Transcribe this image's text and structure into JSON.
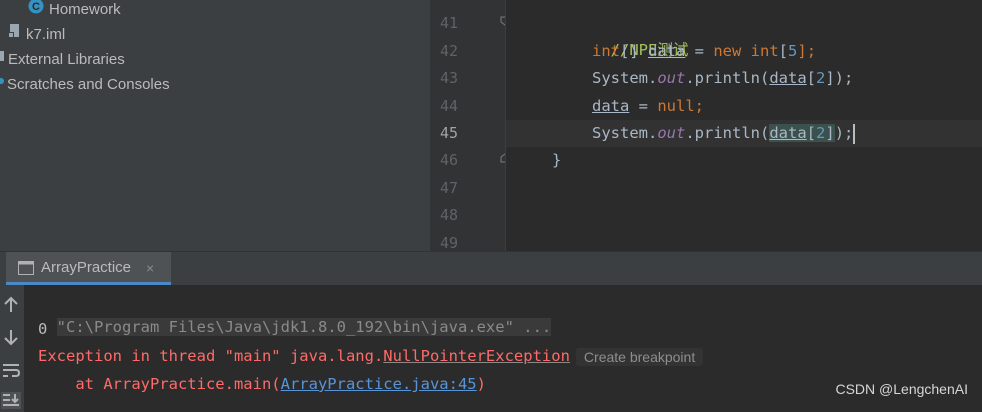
{
  "project_tree": {
    "items": [
      {
        "label": "Homework",
        "icon": "java-class-icon"
      },
      {
        "label": "k7.iml",
        "icon": "module-file-icon"
      },
      {
        "label": "External Libraries",
        "icon": "library-icon"
      },
      {
        "label": "Scratches and Consoles",
        "icon": "scratches-icon"
      }
    ]
  },
  "editor": {
    "line_numbers": [
      "41",
      "42",
      "43",
      "44",
      "45",
      "46",
      "47",
      "48",
      "49"
    ],
    "active_line": "45",
    "lines": {
      "l41": "//NPE测试",
      "l42": [
        "int",
        "[] ",
        "data",
        " = ",
        "new",
        " ",
        "int",
        "[",
        "5",
        "];"
      ],
      "l43": [
        "System.",
        "out",
        ".println(",
        "data",
        "[",
        "2",
        "]);"
      ],
      "l44": [
        "data",
        " = ",
        "null",
        ";"
      ],
      "l45": [
        "System.",
        "out",
        ".println(",
        "data",
        "[",
        "2",
        "]",
        ");"
      ],
      "l46": "}"
    }
  },
  "run_panel": {
    "tab_label": "ArrayPractice",
    "tab_close": "×",
    "console": {
      "cmd": "\"C:\\Program Files\\Java\\jdk1.8.0_192\\bin\\java.exe\" ...",
      "output": "0",
      "exception_prefix": "Exception in thread \"main\" java.lang.",
      "exception_class": "NullPointerException",
      "create_breakpoint": "Create breakpoint",
      "stack_prefix": "    at ArrayPractice.main(",
      "stack_link": "ArrayPractice.java:45",
      "stack_suffix": ")"
    }
  },
  "watermark": "CSDN @LengchenAI"
}
